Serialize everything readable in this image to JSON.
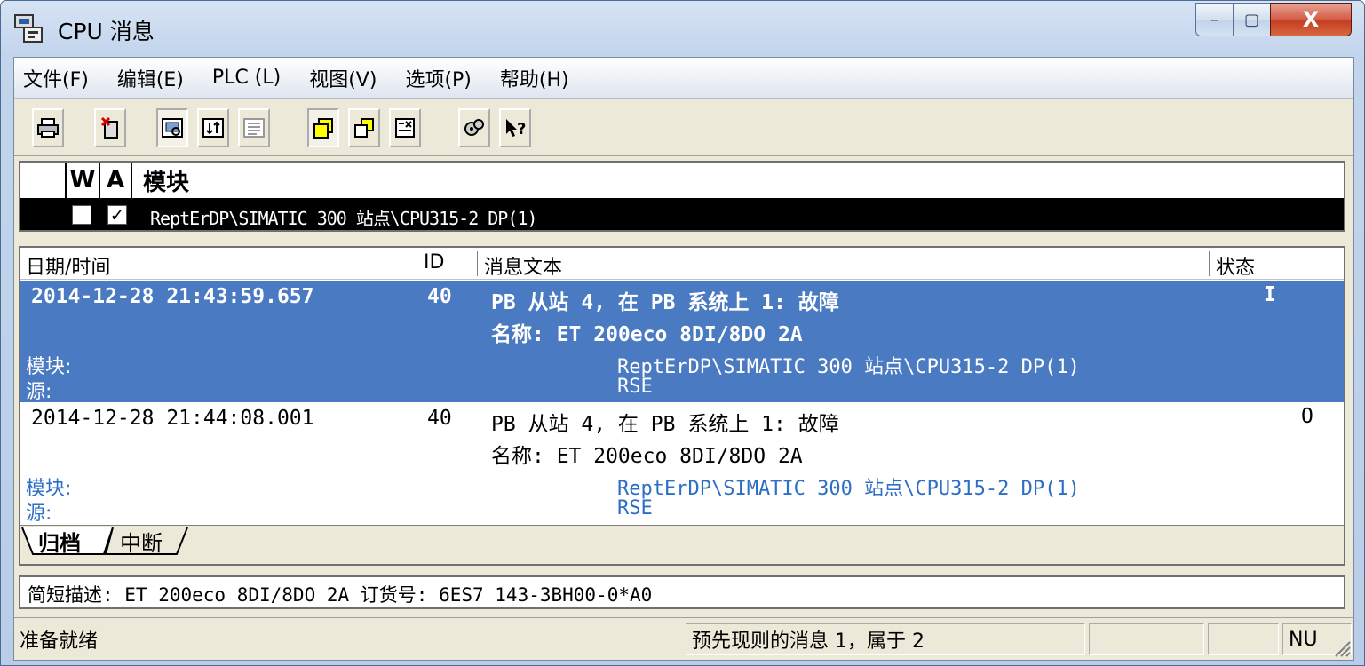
{
  "window": {
    "title": "CPU 消息",
    "min_label": "–",
    "max_label": "▢",
    "close_label": "X"
  },
  "menu": [
    "文件(F)",
    "编辑(E)",
    "PLC (L)",
    "视图(V)",
    "选项(P)",
    "帮助(H)"
  ],
  "toolbar": {
    "icons": [
      "print-icon",
      "delete-icon",
      "archive-view-icon",
      "interrupt-view-icon",
      "text-view-icon",
      "window-front-icon",
      "window-all-icon",
      "filter-icon",
      "settings-icon",
      "context-help-icon"
    ]
  },
  "modules": {
    "col_w": "W",
    "col_a": "A",
    "col_module": "模块",
    "row": {
      "w_checked": "",
      "a_checked": "✓",
      "path": "ReptErDP\\SIMATIC 300 站点\\CPU315-2 DP(1)"
    }
  },
  "messages": {
    "headers": {
      "datetime": "日期/时间",
      "id": "ID",
      "text": "消息文本",
      "status": "状态"
    },
    "rows": [
      {
        "datetime": "2014-12-28 21:43:59.657",
        "id": "40",
        "text": "PB 从站 4, 在 PB 系统上 1: 故障",
        "name": "名称: ET 200eco 8DI/8DO 2A",
        "status": "I",
        "module_label": "模块:",
        "module_value": "ReptErDP\\SIMATIC 300 站点\\CPU315-2 DP(1)",
        "source_label": "源:",
        "source_value": "RSE"
      },
      {
        "datetime": "2014-12-28 21:44:08.001",
        "id": "40",
        "text": "PB 从站 4, 在 PB 系统上 1: 故障",
        "name": "名称: ET 200eco 8DI/8DO 2A",
        "status": "O",
        "module_label": "模块:",
        "module_value": "ReptErDP\\SIMATIC 300 站点\\CPU315-2 DP(1)",
        "source_label": "源:",
        "source_value": "RSE"
      }
    ]
  },
  "tabs": [
    "归档",
    "中断"
  ],
  "description": "简短描述: ET 200eco 8DI/8DO 2A 订货号: 6ES7 143-3BH00-0*A0",
  "status": {
    "ready": "准备就绪",
    "info": "预先现则的消息 1，属于 2",
    "num": "NU"
  },
  "colors": {
    "selected_row": "#4a7ac2",
    "link_text": "#2e6fc6",
    "close_button": "#c23c21"
  }
}
